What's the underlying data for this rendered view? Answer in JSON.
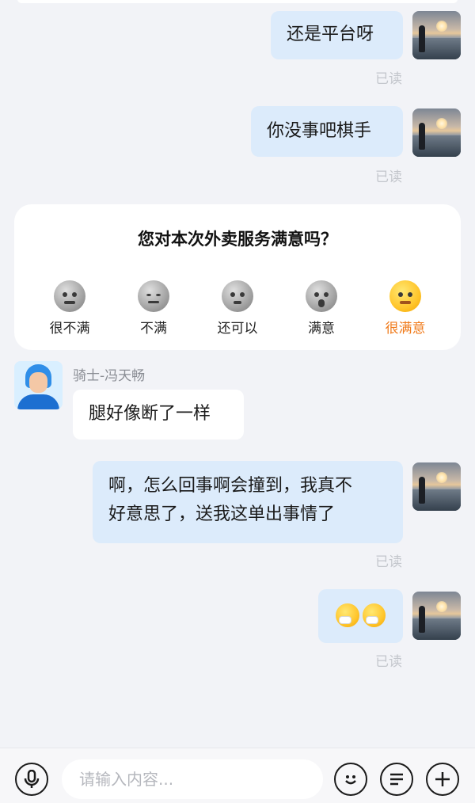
{
  "messages": {
    "m1": {
      "text": "还是平台呀",
      "status": "已读"
    },
    "m2": {
      "text": "你没事吧棋手",
      "status": "已读"
    },
    "rider": {
      "name": "骑士-冯天畅",
      "text": "腿好像断了一样"
    },
    "m3": {
      "line1": "啊，怎么回事啊会撞到，我真不",
      "line2": "好意思了，送我这单出事情了",
      "status": "已读"
    },
    "m4": {
      "emoji": [
        "face-with-medical-mask-icon",
        "face-with-medical-mask-icon"
      ],
      "status": "已读"
    }
  },
  "rating": {
    "title": "您对本次外卖服务满意吗？",
    "options": [
      {
        "label": "很不满",
        "icon": "angry-face-icon"
      },
      {
        "label": "不满",
        "icon": "unamused-face-icon"
      },
      {
        "label": "还可以",
        "icon": "neutral-face-icon"
      },
      {
        "label": "满意",
        "icon": "surprised-face-icon"
      },
      {
        "label": "很满意",
        "icon": "thinking-face-icon"
      }
    ],
    "highlight_color": "#f07a1a"
  },
  "input": {
    "placeholder": "请输入内容..."
  },
  "colors": {
    "my_bubble": "#dcebfb",
    "other_bubble": "#ffffff",
    "background": "#f2f3f7"
  }
}
